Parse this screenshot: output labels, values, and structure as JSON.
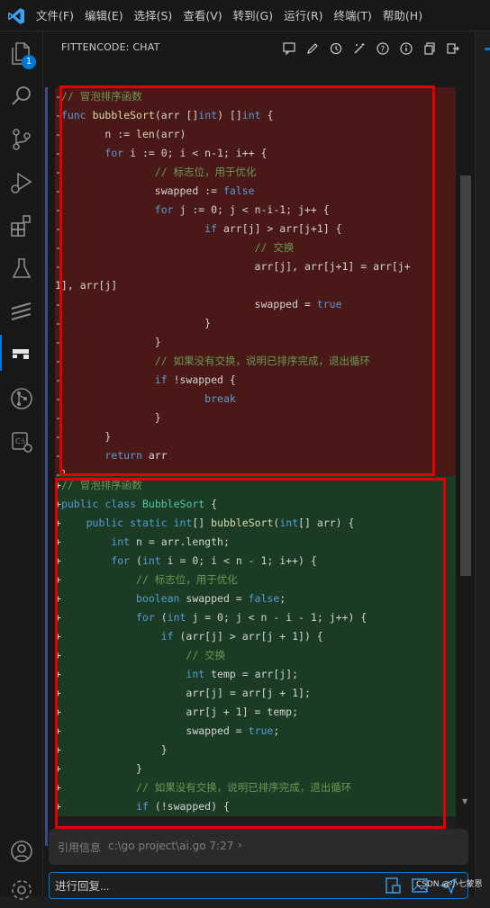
{
  "menu": [
    "文件(F)",
    "编辑(E)",
    "选择(S)",
    "查看(V)",
    "转到(G)",
    "运行(R)",
    "终端(T)",
    "帮助(H)"
  ],
  "activity": {
    "badge_count": "1",
    "items": [
      "explorer-icon",
      "search-icon",
      "source-control-icon",
      "run-debug-icon",
      "extensions-icon",
      "testing-icon",
      "lines-icon",
      "fittencode-icon",
      "git-graph-icon",
      "remote-icon",
      "account-icon",
      "manage-icon"
    ]
  },
  "panel": {
    "title": "FITTENCODE: CHAT",
    "actions": [
      "chat-icon",
      "edit-icon",
      "history-icon",
      "magic-icon",
      "help-icon",
      "info-icon",
      "copy-icon",
      "exit-icon"
    ]
  },
  "diff": {
    "removed": [
      "-// 冒泡排序函数",
      "-func bubbleSort(arr []int) []int {",
      "-       n := len(arr)",
      "-       for i := 0; i < n-1; i++ {",
      "-               // 标志位，用于优化",
      "-               swapped := false",
      "-               for j := 0; j < n-i-1; j++ {",
      "-                       if arr[j] > arr[j+1] {",
      "-                               // 交换",
      "-                               arr[j], arr[j+1] = arr[j+",
      "1], arr[j]",
      "-                               swapped = true",
      "-                       }",
      "-               }",
      "-               // 如果没有交换，说明已排序完成，退出循环",
      "-               if !swapped {",
      "-                       break",
      "-               }",
      "-       }",
      "-       return arr",
      "-}"
    ],
    "added": [
      "+// 冒泡排序函数",
      "+public class BubbleSort {",
      "+    public static int[] bubbleSort(int[] arr) {",
      "+        int n = arr.length;",
      "+        for (int i = 0; i < n - 1; i++) {",
      "+            // 标志位，用于优化",
      "+            boolean swapped = false;",
      "+            for (int j = 0; j < n - i - 1; j++) {",
      "+                if (arr[j] > arr[j + 1]) {",
      "+                    // 交换",
      "+                    int temp = arr[j];",
      "+                    arr[j] = arr[j + 1];",
      "+                    arr[j + 1] = temp;",
      "+                    swapped = true;",
      "+                }",
      "+            }",
      "+            // 如果没有交换，说明已排序完成，退出循环",
      "+            if (!swapped) {"
    ]
  },
  "citation": {
    "label": "引用信息",
    "path": "c:\\go project\\ai.go 7:27",
    "chevron": "›"
  },
  "reply": {
    "placeholder": "进行回复..."
  },
  "watermark": "CSDN @小七蒙恩",
  "colors": {
    "accent": "#0078d4",
    "removed_bg": "#4b1818",
    "added_bg": "#1b3b24",
    "highlight_box": "#e00000"
  }
}
